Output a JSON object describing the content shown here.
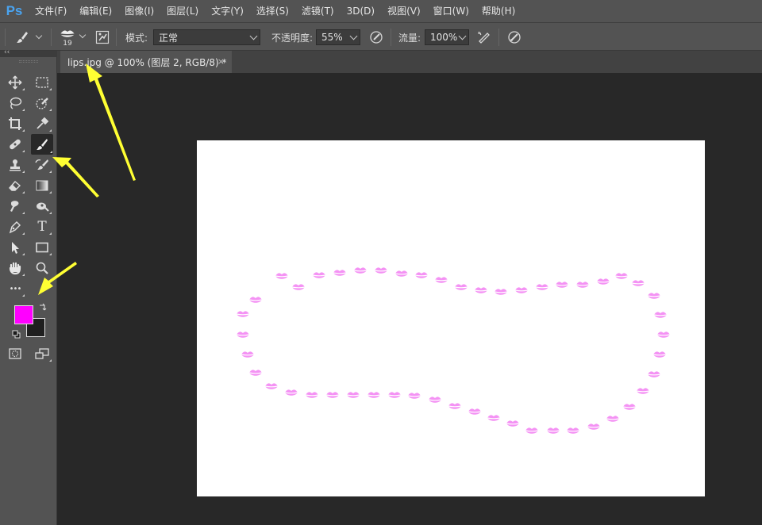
{
  "app": {
    "logo": "Ps"
  },
  "menu": [
    "文件(F)",
    "编辑(E)",
    "图像(I)",
    "图层(L)",
    "文字(Y)",
    "选择(S)",
    "滤镜(T)",
    "3D(D)",
    "视图(V)",
    "窗口(W)",
    "帮助(H)"
  ],
  "options": {
    "brush_size": "19",
    "mode_label": "模式:",
    "mode_value": "正常",
    "opacity_label": "不透明度:",
    "opacity_value": "55%",
    "flow_label": "流量:",
    "flow_value": "100%"
  },
  "tab": {
    "title": "lips.jpg @ 100% (图层 2, RGB/8) *",
    "close": "×"
  },
  "tools": {
    "selected": "brush-tool",
    "type_glyph": "T",
    "more_glyph": "•••"
  },
  "colors": {
    "foreground": "#ff00ff",
    "background": "#1f1f1f",
    "lips": "#f06ef0",
    "annotation_arrow": "#ffff33"
  },
  "icons": [
    "brush-icon",
    "brush-preset-icon",
    "brush-panel-icon",
    "airbrush-icon",
    "pressure-flow-icon",
    "pressure-size-icon",
    "move-icon",
    "marquee-icon",
    "lasso-icon",
    "quick-select-icon",
    "crop-icon",
    "eyedropper-icon",
    "healing-icon",
    "brush-icon",
    "stamp-icon",
    "history-brush-icon",
    "eraser-icon",
    "gradient-icon",
    "smudge-icon",
    "dodge-icon",
    "pen-icon",
    "type-icon",
    "path-select-icon",
    "rectangle-icon",
    "hand-icon",
    "zoom-icon",
    "more-icon",
    "swap-icon",
    "default-colors-icon",
    "quick-mask-icon",
    "screen-mode-icon"
  ]
}
